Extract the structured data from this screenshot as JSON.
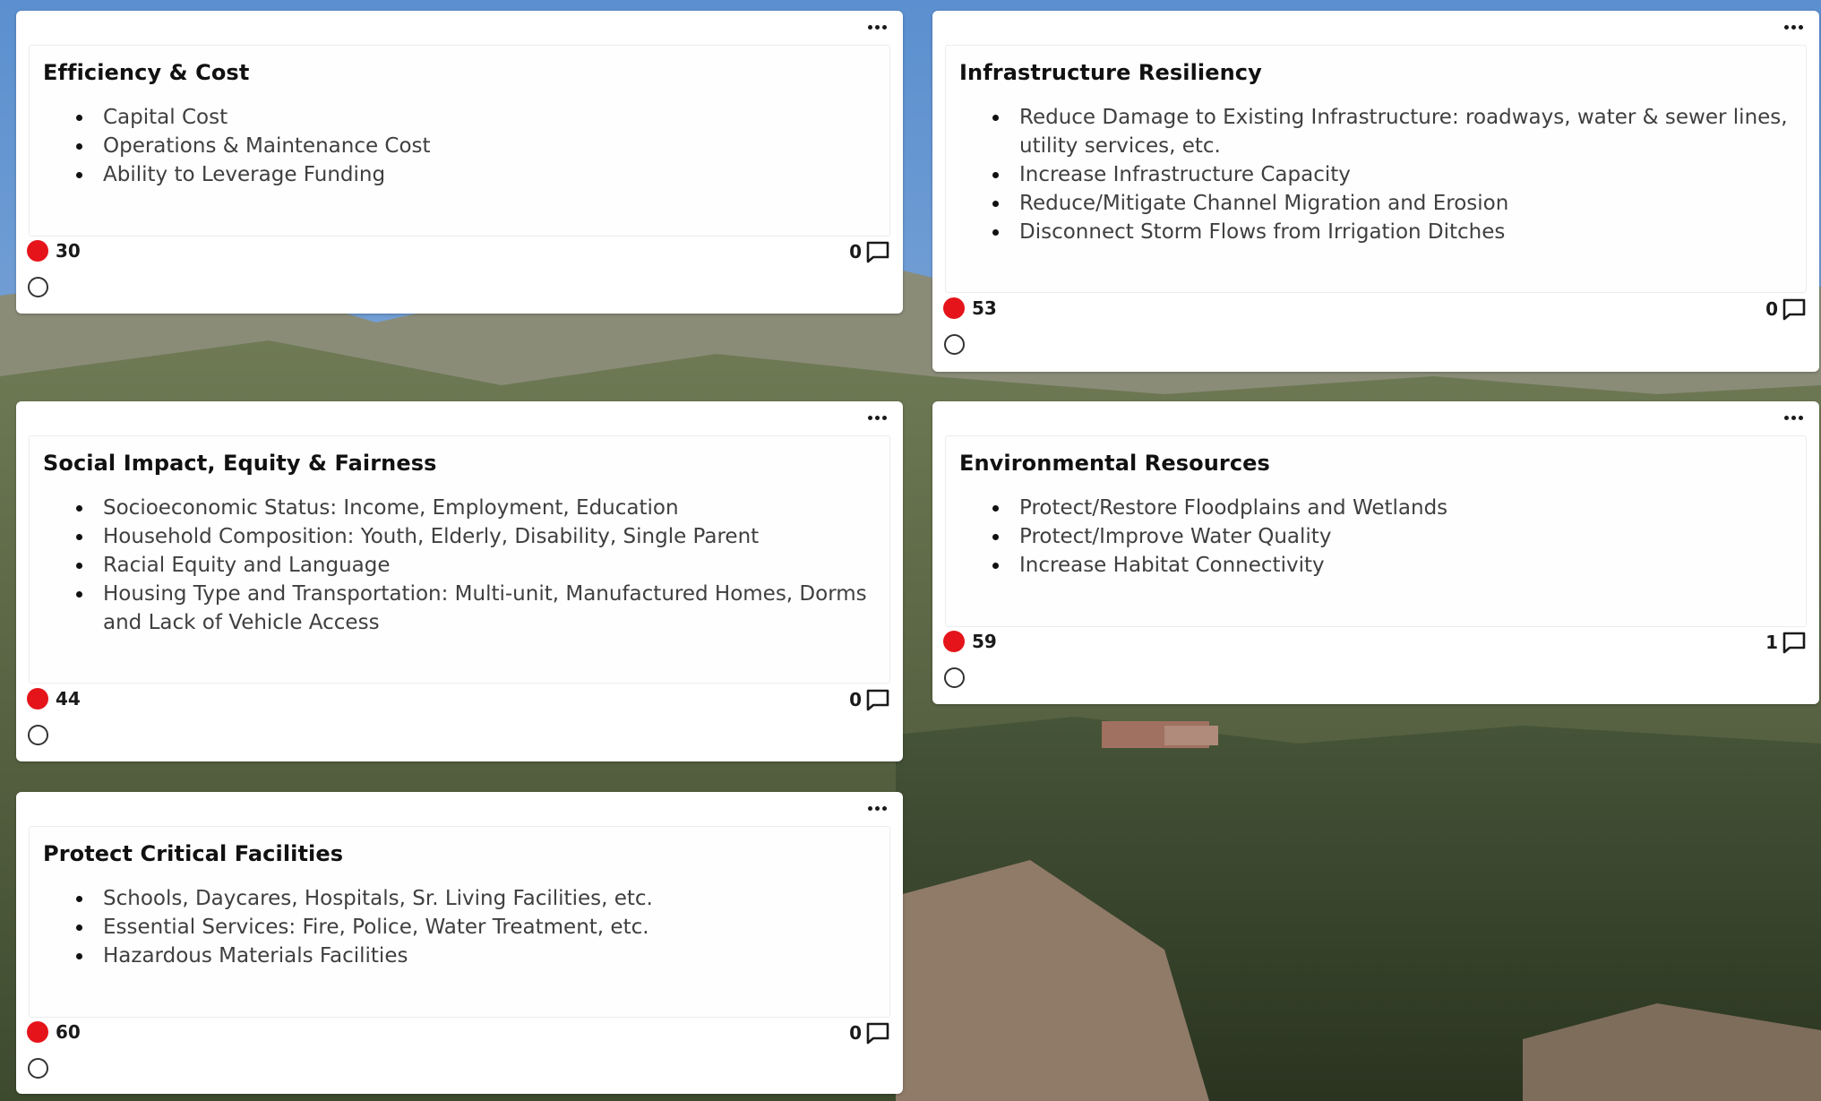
{
  "colors": {
    "vote_dot": "#e5141b",
    "card_bg": "#ffffff"
  },
  "cards": [
    {
      "title": "Efficiency & Cost",
      "items": [
        "Capital Cost",
        "Operations & Maintenance Cost",
        "Ability to Leverage Funding"
      ],
      "votes": "30",
      "comments": "0"
    },
    {
      "title": "Infrastructure Resiliency",
      "items": [
        "Reduce Damage to Existing Infrastructure: roadways, water & sewer lines, utility services, etc.",
        "Increase Infrastructure Capacity",
        "Reduce/Mitigate Channel Migration and Erosion",
        "Disconnect Storm Flows from Irrigation Ditches"
      ],
      "votes": "53",
      "comments": "0"
    },
    {
      "title": "Social Impact, Equity & Fairness",
      "items": [
        "Socioeconomic Status: Income, Employment, Education",
        "Household Composition: Youth, Elderly, Disability, Single Parent",
        "Racial Equity and Language",
        "Housing Type and Transportation: Multi-unit, Manufactured Homes, Dorms and Lack of Vehicle Access"
      ],
      "votes": "44",
      "comments": "0"
    },
    {
      "title": "Environmental Resources",
      "items": [
        "Protect/Restore Floodplains and Wetlands",
        "Protect/Improve Water Quality",
        "Increase Habitat Connectivity"
      ],
      "votes": "59",
      "comments": "1"
    },
    {
      "title": "Protect Critical Facilities",
      "items": [
        "Schools, Daycares, Hospitals, Sr. Living Facilities, etc.",
        "Essential Services: Fire, Police, Water Treatment, etc.",
        "Hazardous Materials Facilities"
      ],
      "votes": "60",
      "comments": "0"
    }
  ]
}
